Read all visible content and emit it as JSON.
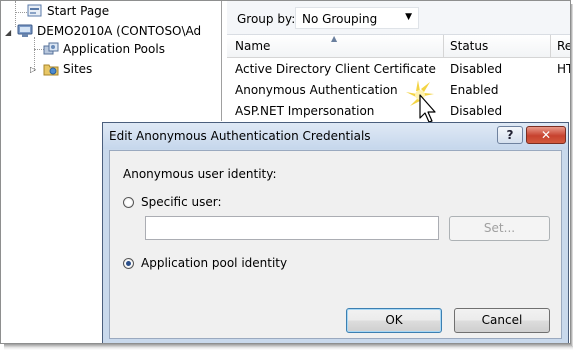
{
  "tree": {
    "items": [
      {
        "label": "Start Page"
      },
      {
        "label": "DEMO2010A (CONTOSO\\Ad"
      },
      {
        "label": "Application Pools"
      },
      {
        "label": "Sites"
      }
    ]
  },
  "features": {
    "group_by_label": "Group by:",
    "group_by_value": "No Grouping",
    "columns": [
      "Name",
      "Status",
      "Re"
    ],
    "rows": [
      {
        "name": "Active Directory Client Certificate ...",
        "status": "Disabled",
        "extra": "HT"
      },
      {
        "name": "Anonymous Authentication",
        "status": "Enabled",
        "extra": ""
      },
      {
        "name": "ASP.NET Impersonation",
        "status": "Disabled",
        "extra": ""
      }
    ]
  },
  "dialog": {
    "title": "Edit Anonymous Authentication Credentials",
    "help_label": "?",
    "close_label": "✕",
    "section_label": "Anonymous user identity:",
    "specific_user_label": "Specific user:",
    "specific_user_value": "",
    "set_button": "Set...",
    "app_pool_label": "Application pool identity",
    "selected_option": "Application pool identity",
    "ok_button": "OK",
    "cancel_button": "Cancel"
  },
  "colors": {
    "dialog_frame": "#c9d9ec",
    "close_button": "#c7422f",
    "default_button_border": "#3c7fb1"
  }
}
